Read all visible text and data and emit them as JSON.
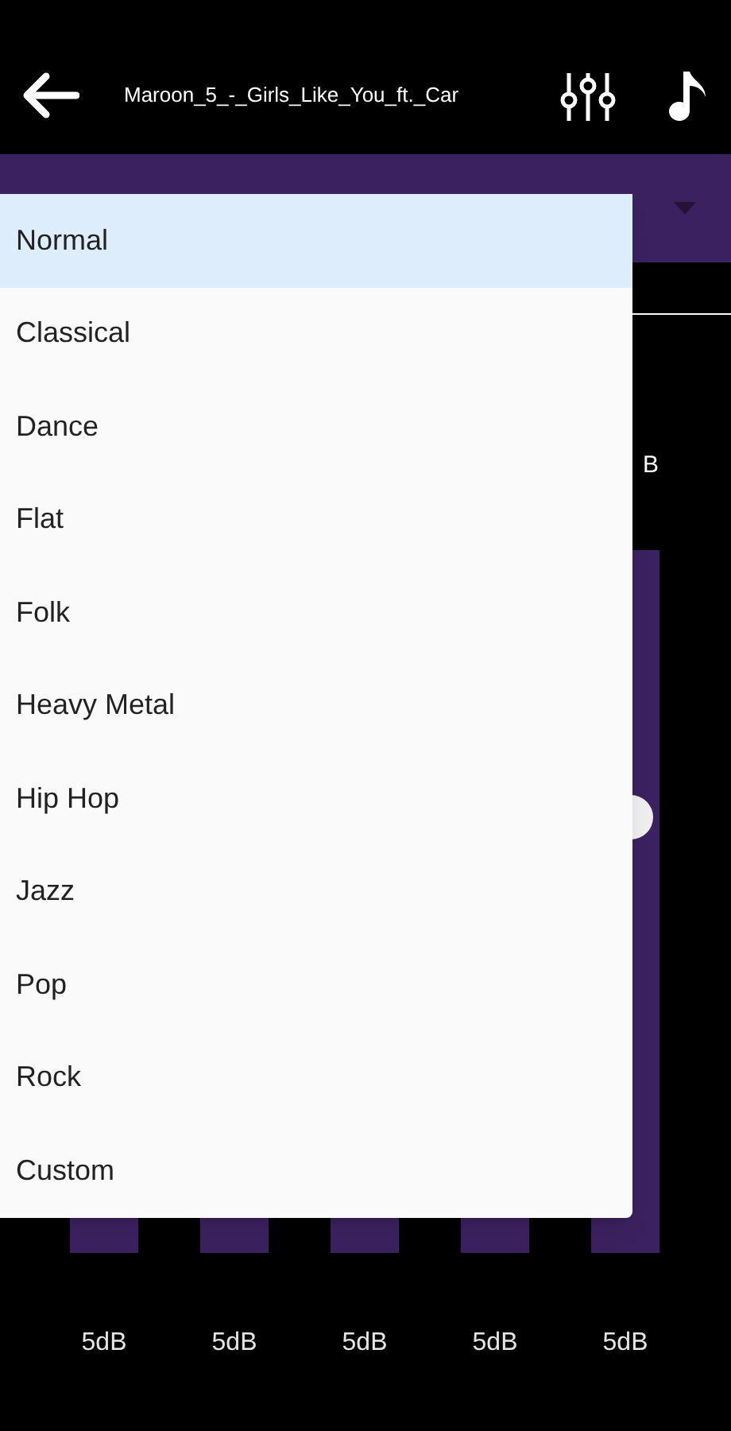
{
  "header": {
    "title": "Maroon_5_-_Girls_Like_You_ft._Car"
  },
  "preset_menu": {
    "items": [
      {
        "label": "Normal",
        "selected": true
      },
      {
        "label": "Classical",
        "selected": false
      },
      {
        "label": "Dance",
        "selected": false
      },
      {
        "label": "Flat",
        "selected": false
      },
      {
        "label": "Folk",
        "selected": false
      },
      {
        "label": "Heavy Metal",
        "selected": false
      },
      {
        "label": "Hip Hop",
        "selected": false
      },
      {
        "label": "Jazz",
        "selected": false
      },
      {
        "label": "Pop",
        "selected": false
      },
      {
        "label": "Rock",
        "selected": false
      },
      {
        "label": "Custom",
        "selected": false
      }
    ]
  },
  "bands": [
    {
      "reading": "5dB"
    },
    {
      "reading": "5dB"
    },
    {
      "reading": "5dB"
    },
    {
      "reading": "5dB"
    },
    {
      "top_label": "B",
      "level": 0.62,
      "reading": "5dB"
    }
  ]
}
